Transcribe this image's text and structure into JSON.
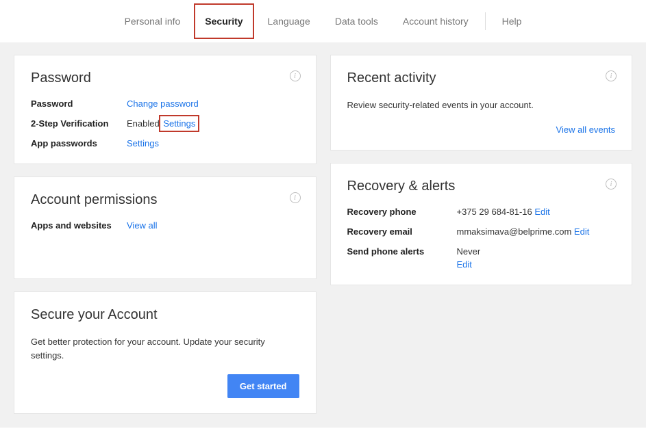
{
  "tabs": {
    "personal_info": "Personal info",
    "security": "Security",
    "language": "Language",
    "data_tools": "Data tools",
    "account_history": "Account history",
    "help": "Help"
  },
  "password_card": {
    "title": "Password",
    "rows": {
      "password": {
        "label": "Password",
        "link": "Change password"
      },
      "two_step": {
        "label": "2-Step Verification",
        "status": "Enabled",
        "link": "Settings"
      },
      "app_pw": {
        "label": "App passwords",
        "link": "Settings"
      }
    }
  },
  "permissions_card": {
    "title": "Account permissions",
    "row": {
      "label": "Apps and websites",
      "link": "View all"
    }
  },
  "secure_card": {
    "title": "Secure your Account",
    "desc": "Get better protection for your account. Update your security settings.",
    "button": "Get started"
  },
  "activity_card": {
    "title": "Recent activity",
    "desc": "Review security-related events in your account.",
    "link": "View all events"
  },
  "recovery_card": {
    "title": "Recovery & alerts",
    "phone": {
      "label": "Recovery phone",
      "value": "+375 29 684-81-16",
      "edit": "Edit"
    },
    "email": {
      "label": "Recovery email",
      "value": "mmaksimava@belprime.com",
      "edit": "Edit"
    },
    "alerts": {
      "label": "Send phone alerts",
      "value": "Never",
      "edit": "Edit"
    }
  },
  "icons": {
    "info": "i"
  }
}
